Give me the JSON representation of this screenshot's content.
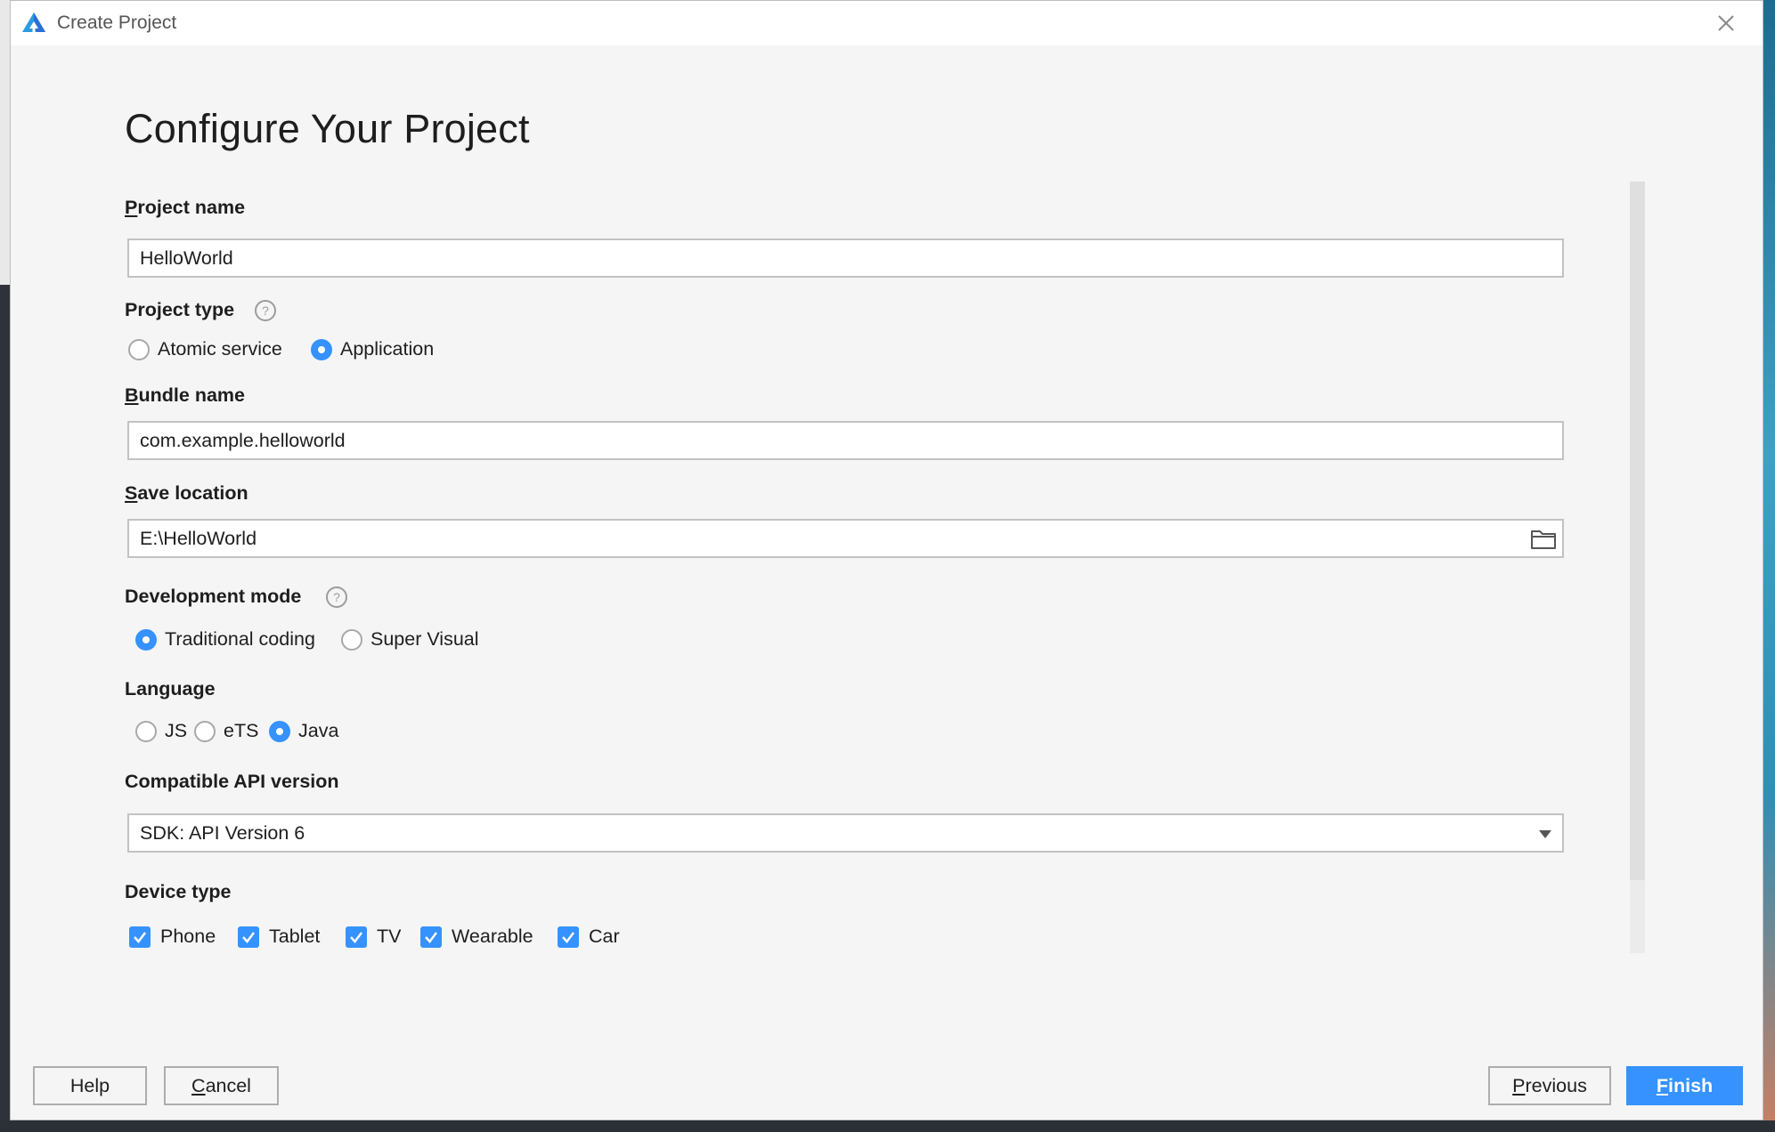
{
  "window": {
    "title": "Create Project",
    "icons": {
      "app": "harmony-logo-icon",
      "close": "close-icon"
    }
  },
  "page": {
    "heading": "Configure Your Project"
  },
  "form": {
    "project_name": {
      "label_mnemonic": "P",
      "label_rest": "roject name",
      "value": "HelloWorld"
    },
    "project_type": {
      "label": "Project type",
      "help_icon": "question-circle-icon",
      "options": [
        {
          "label": "Atomic service",
          "selected": false
        },
        {
          "label": "Application",
          "selected": true
        }
      ]
    },
    "bundle_name": {
      "label_mnemonic": "B",
      "label_rest": "undle name",
      "value": "com.example.helloworld"
    },
    "save_location": {
      "label_mnemonic": "S",
      "label_rest": "ave location",
      "value": "E:\\HelloWorld",
      "browse_icon": "folder-icon"
    },
    "development_mode": {
      "label": "Development mode",
      "help_icon": "question-circle-icon",
      "options": [
        {
          "label": "Traditional coding",
          "selected": true
        },
        {
          "label": "Super Visual",
          "selected": false
        }
      ]
    },
    "language": {
      "label": "Language",
      "options": [
        {
          "label": "JS",
          "selected": false
        },
        {
          "label": "eTS",
          "selected": false
        },
        {
          "label": "Java",
          "selected": true
        }
      ]
    },
    "compatible_api": {
      "label": "Compatible API version",
      "value": "SDK: API Version 6",
      "dropdown_icon": "chevron-down-icon"
    },
    "device_type": {
      "label": "Device type",
      "options": [
        {
          "label": "Phone",
          "checked": true
        },
        {
          "label": "Tablet",
          "checked": true
        },
        {
          "label": "TV",
          "checked": true
        },
        {
          "label": "Wearable",
          "checked": true
        },
        {
          "label": "Car",
          "checked": true
        }
      ]
    }
  },
  "footer": {
    "help": "Help",
    "cancel_mnemonic": "C",
    "cancel_rest": "ancel",
    "previous_mnemonic": "P",
    "previous_rest": "revious",
    "finish_mnemonic": "F",
    "finish_rest": "inish"
  },
  "colors": {
    "accent": "#3592ff",
    "background": "#f5f5f5",
    "titlebar": "#ffffff"
  }
}
